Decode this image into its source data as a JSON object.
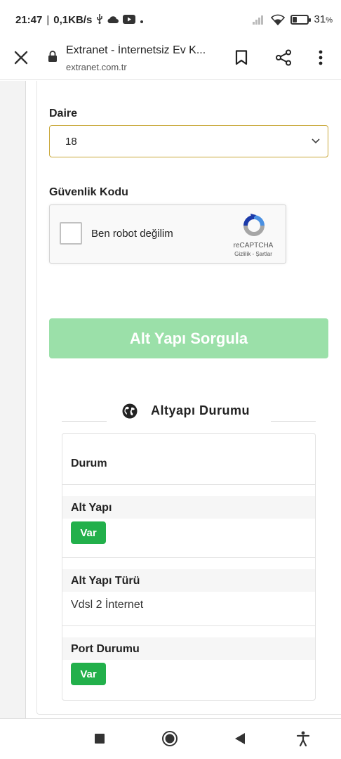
{
  "status_bar": {
    "time": "21:47",
    "net_speed": "0,1KB/s",
    "battery_percent": "31",
    "battery_level": 0.31
  },
  "browser": {
    "title": "Extranet - İnternetsiz Ev K...",
    "url": "extranet.com.tr"
  },
  "form": {
    "daire_label": "Daire",
    "daire_value": "18",
    "security_label": "Güvenlik Kodu",
    "captcha_label": "Ben robot değilim",
    "captcha_brand": "reCAPTCHA",
    "captcha_terms": "Gizlilik - Şartlar",
    "submit_label": "Alt Yapı Sorgula"
  },
  "results": {
    "section_title": "Altyapı Durumu",
    "header": "Durum",
    "rows": [
      {
        "label": "Alt Yapı",
        "badge": "Var"
      },
      {
        "label": "Alt Yapı Türü",
        "value": "Vdsl 2 İnternet"
      },
      {
        "label": "Port Durumu",
        "badge": "Var"
      }
    ]
  },
  "colors": {
    "submit_bg": "#9be0a9",
    "badge_bg": "#22b04b",
    "select_border": "#c9a83a"
  }
}
